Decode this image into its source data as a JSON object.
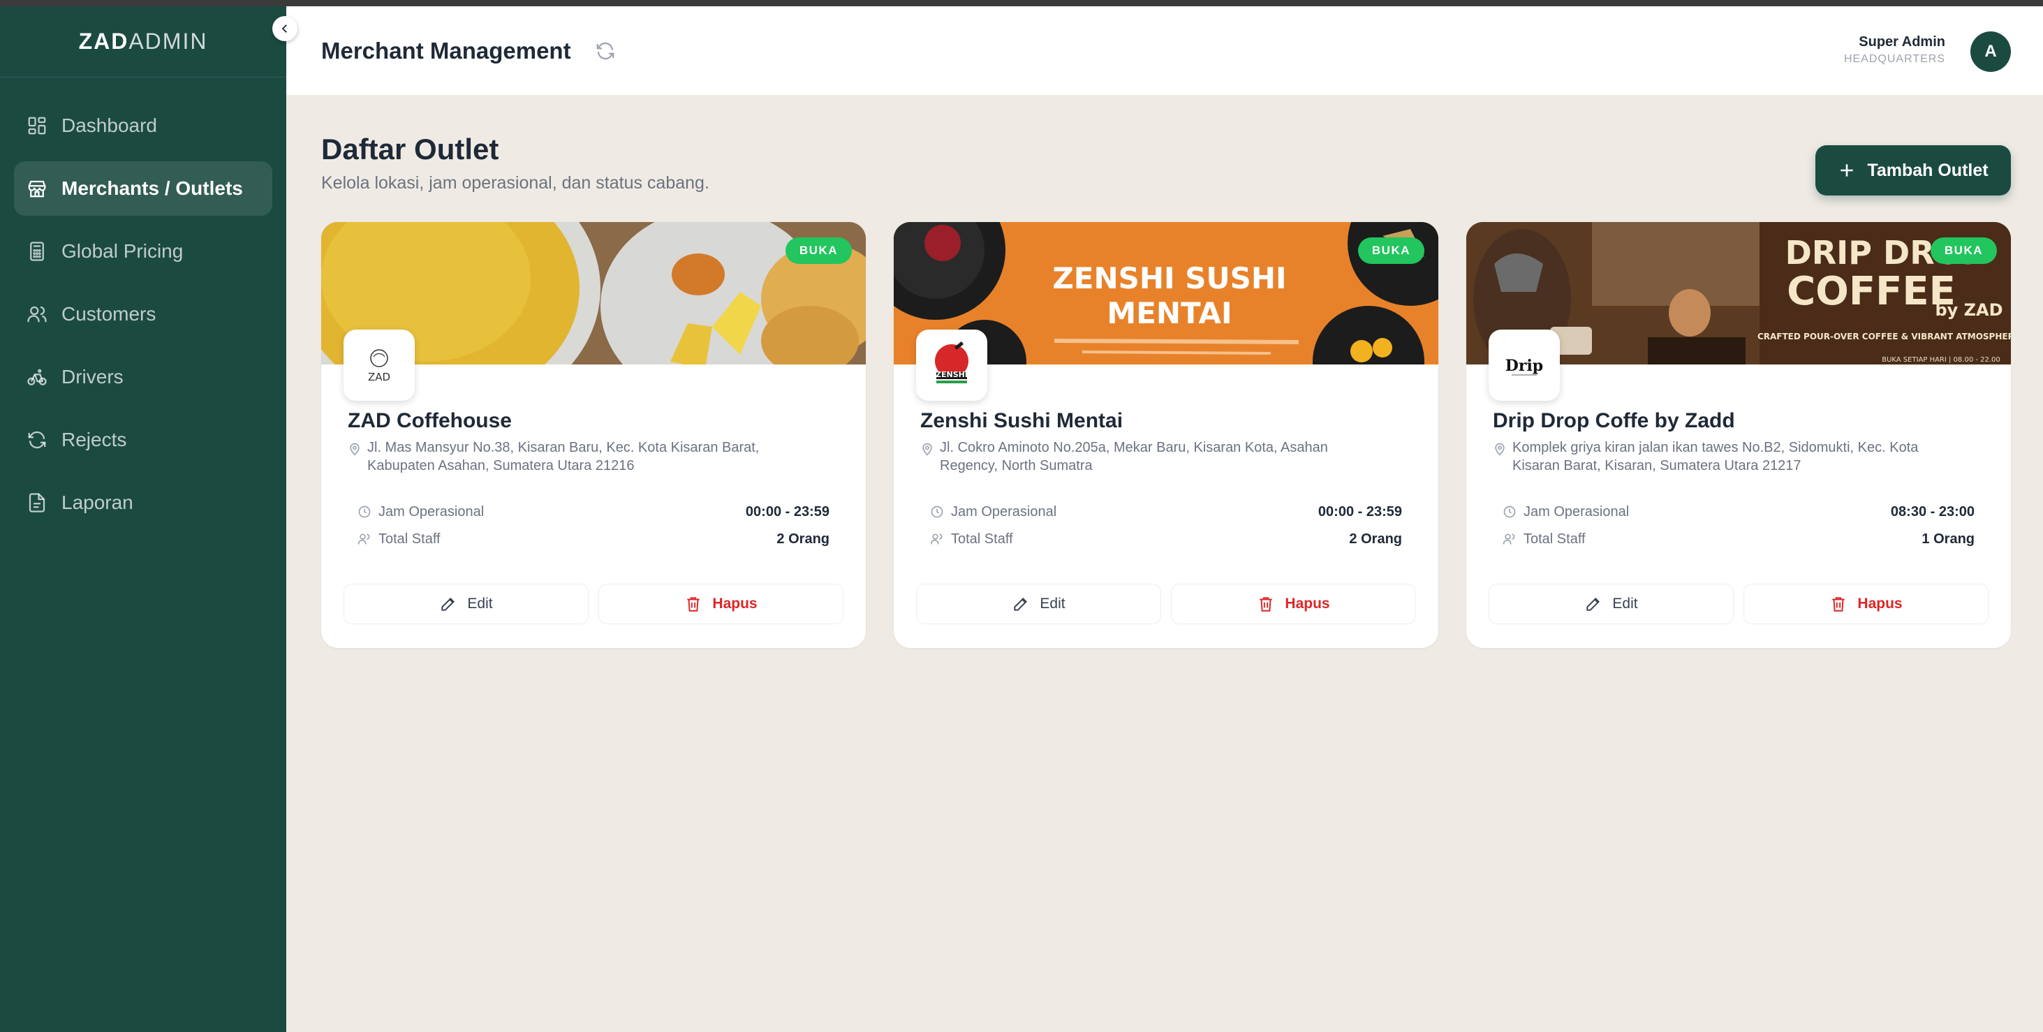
{
  "brand": {
    "bold": "ZAD",
    "light": "ADMIN"
  },
  "sidebar": {
    "items": [
      {
        "label": "Dashboard",
        "icon": "dashboard-grid-icon",
        "active": false
      },
      {
        "label": "Merchants / Outlets",
        "icon": "store-icon",
        "active": true
      },
      {
        "label": "Global Pricing",
        "icon": "calculator-icon",
        "active": false
      },
      {
        "label": "Customers",
        "icon": "users-icon",
        "active": false
      },
      {
        "label": "Drivers",
        "icon": "bicycle-icon",
        "active": false
      },
      {
        "label": "Rejects",
        "icon": "refresh-icon",
        "active": false
      },
      {
        "label": "Laporan",
        "icon": "report-file-icon",
        "active": false
      }
    ]
  },
  "header": {
    "title": "Merchant Management",
    "user": {
      "name": "Super Admin",
      "role": "HEADQUARTERS",
      "initial": "A"
    }
  },
  "main": {
    "title": "Daftar Outlet",
    "subtitle": "Kelola lokasi, jam operasional, dan status cabang.",
    "add_button": "Tambah Outlet"
  },
  "outlets": [
    {
      "name": "ZAD Coffehouse",
      "status": "BUKA",
      "address": "Jl. Mas Mansyur No.38, Kisaran Baru, Kec. Kota Kisaran Barat, Kabupaten Asahan, Sumatera Utara 21216",
      "hours_label": "Jam Operasional",
      "hours": "00:00 - 23:59",
      "staff_label": "Total Staff",
      "staff": "2 Orang",
      "edit_label": "Edit",
      "delete_label": "Hapus",
      "logo_text": "ZAD"
    },
    {
      "name": "Zenshi Sushi Mentai",
      "status": "BUKA",
      "address": "Jl. Cokro Aminoto No.205a, Mekar Baru, Kisaran Kota, Asahan Regency, North Sumatra",
      "hours_label": "Jam Operasional",
      "hours": "00:00 - 23:59",
      "staff_label": "Total Staff",
      "staff": "2 Orang",
      "edit_label": "Edit",
      "delete_label": "Hapus",
      "banner_line1": "ZENSHI SUSHI",
      "banner_line2": "MENTAI",
      "logo_text": "ZENSHI"
    },
    {
      "name": "Drip Drop Coffe by Zadd",
      "status": "BUKA",
      "address": "Komplek griya kiran jalan ikan tawes No.B2, Sidomukti, Kec. Kota Kisaran Barat, Kisaran, Sumatera Utara 21217",
      "hours_label": "Jam Operasional",
      "hours": "08:30 - 23:00",
      "staff_label": "Total Staff",
      "staff": "1 Orang",
      "edit_label": "Edit",
      "delete_label": "Hapus",
      "banner_line1": "DRIP DROP",
      "banner_line2": "COFFEE",
      "banner_by": "by ZAD",
      "banner_tagline": "CRAFTED POUR-OVER COFFEE & VIBRANT ATMOSPHERE",
      "banner_hours": "BUKA SETIAP HARI | 08.00 - 22.00",
      "logo_text": "Drip"
    }
  ],
  "colors": {
    "primary": "#1b4a41",
    "badge": "#22c55e",
    "danger": "#dc2626",
    "background": "#efebe4"
  }
}
